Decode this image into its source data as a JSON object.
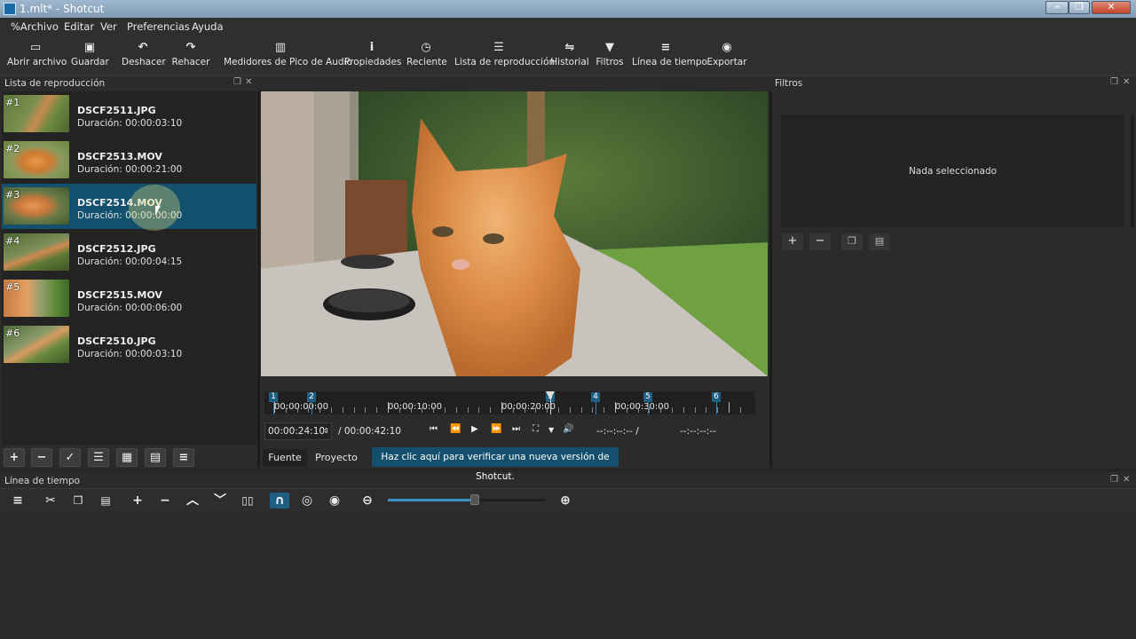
{
  "window": {
    "title": "1.mlt* - Shotcut"
  },
  "menu": [
    "%Archivo",
    "Editar",
    "Ver",
    "Preferencias",
    "Ayuda"
  ],
  "toolbar": [
    {
      "label": "Abrir archivo",
      "icon": "folder-icon"
    },
    {
      "label": "Guardar",
      "icon": "save-icon"
    },
    {
      "label": "Deshacer",
      "icon": "undo-icon"
    },
    {
      "label": "Rehacer",
      "icon": "redo-icon"
    },
    {
      "label": "Medidores de Pico de Audio",
      "icon": "audio-meter-icon"
    },
    {
      "label": "Propiedades",
      "icon": "info-icon"
    },
    {
      "label": "Reciente",
      "icon": "clock-icon"
    },
    {
      "label": "Lista de reproducción",
      "icon": "list-icon"
    },
    {
      "label": "Historial",
      "icon": "history-icon"
    },
    {
      "label": "Filtros",
      "icon": "filter-icon"
    },
    {
      "label": "Línea de tiempo",
      "icon": "timeline-icon"
    },
    {
      "label": "Exportar",
      "icon": "export-icon"
    }
  ],
  "playlist": {
    "title": "Lista de reproducción",
    "items": [
      {
        "num": "#1",
        "name": "DSCF2511.JPG",
        "duration": "Duración: 00:00:03:10"
      },
      {
        "num": "#2",
        "name": "DSCF2513.MOV",
        "duration": "Duración: 00:00:21:00"
      },
      {
        "num": "#3",
        "name": "DSCF2514.MOV",
        "duration": "Duración: 00:00:00:00",
        "selected": true
      },
      {
        "num": "#4",
        "name": "DSCF2512.JPG",
        "duration": "Duración: 00:00:04:15"
      },
      {
        "num": "#5",
        "name": "DSCF2515.MOV",
        "duration": "Duración: 00:00:06:00"
      },
      {
        "num": "#6",
        "name": "DSCF2510.JPG",
        "duration": "Duración: 00:00:03:10"
      }
    ]
  },
  "player": {
    "ruler_labels": [
      "00:00:00:00",
      "00:00:10:00",
      "00:00:20:00",
      "00:00:30:00"
    ],
    "markers": [
      "1",
      "2",
      "3",
      "4",
      "5",
      "6"
    ],
    "position": "00:00:24:10",
    "duration": "/ 00:00:42:10",
    "in_point": "--:--:--:-- /",
    "out_point": "--:--:--:--",
    "tab_source": "Fuente",
    "tab_project": "Proyecto",
    "notice": "Haz clic aquí para verificar una nueva versión de Shotcut."
  },
  "filters": {
    "title": "Filtros",
    "empty_text": "Nada seleccionado"
  },
  "timeline": {
    "title": "Línea de tiempo",
    "zoom_level": 0.55
  },
  "colors": {
    "accent": "#14506d",
    "selection": "#13506d"
  }
}
